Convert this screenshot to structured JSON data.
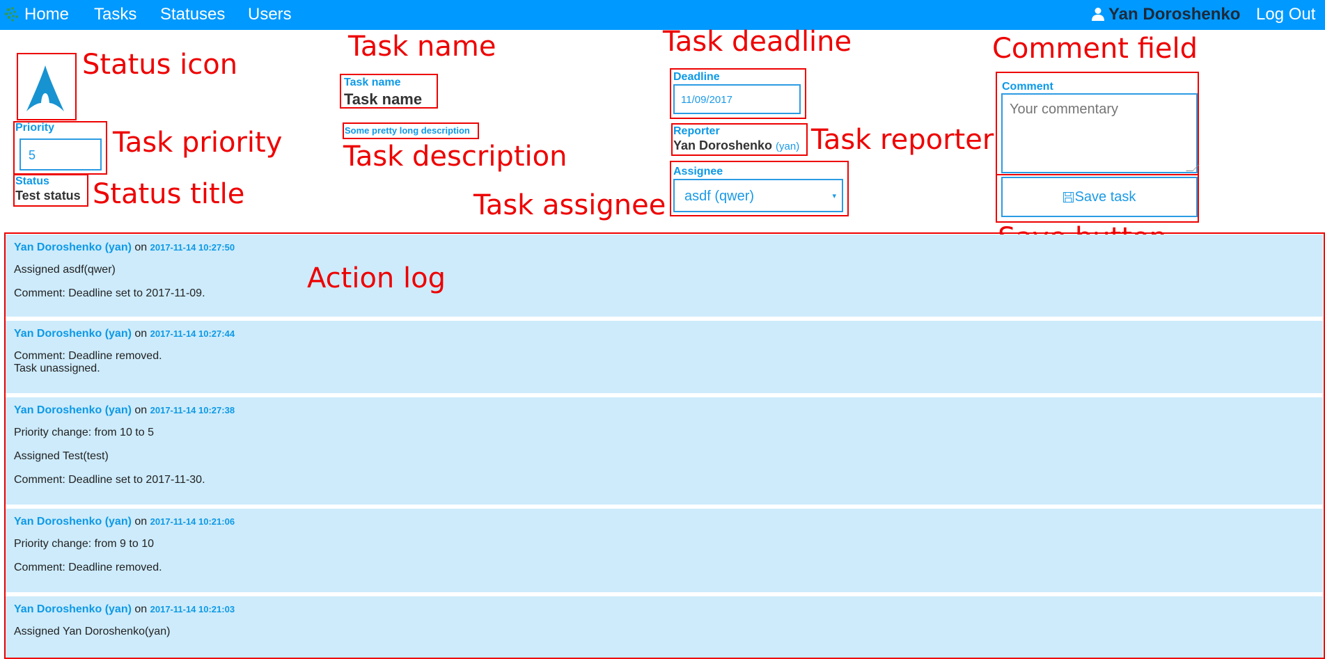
{
  "nav": {
    "links": [
      "Home",
      "Tasks",
      "Statuses",
      "Users"
    ],
    "user": "Yan Doroshenko",
    "logout": "Log Out"
  },
  "task": {
    "priority_label": "Priority",
    "priority_value": "5",
    "status_label": "Status",
    "status_value": "Test status",
    "name_label": "Task name",
    "name_value": "Task name",
    "description": "Some pretty long description",
    "deadline_label": "Deadline",
    "deadline_value": "11/09/2017",
    "reporter_label": "Reporter",
    "reporter_name": "Yan Doroshenko",
    "reporter_login": "(yan)",
    "assignee_label": "Assignee",
    "assignee_value": "asdf (qwer)",
    "comment_label": "Comment",
    "comment_placeholder": "Your commentary",
    "save_label": "Save task"
  },
  "annotations": {
    "status_icon": "Status icon",
    "task_name": "Task name",
    "task_deadline": "Task deadline",
    "comment_field": "Comment field",
    "task_priority": "Task priority",
    "task_description": "Task description",
    "task_reporter": "Task reporter",
    "status_title": "Status title",
    "task_assignee": "Task assignee",
    "save_button": "Save button",
    "action_log": "Action log"
  },
  "log": [
    {
      "author": "Yan Doroshenko (yan)",
      "on": "on",
      "time": "2017-11-14 10:27:50",
      "lines": [
        "Assigned asdf(qwer)",
        "Comment: Deadline set to 2017-11-09."
      ]
    },
    {
      "author": "Yan Doroshenko (yan)",
      "on": "on",
      "time": "2017-11-14 10:27:44",
      "lines": [
        "Comment: Deadline removed.",
        "Task unassigned."
      ]
    },
    {
      "author": "Yan Doroshenko (yan)",
      "on": "on",
      "time": "2017-11-14 10:27:38",
      "lines": [
        "Priority change: from 10 to 5",
        "Assigned Test(test)",
        "Comment: Deadline set to 2017-11-30."
      ]
    },
    {
      "author": "Yan Doroshenko (yan)",
      "on": "on",
      "time": "2017-11-14 10:21:06",
      "lines": [
        "Priority change: from 9 to 10",
        "Comment: Deadline removed."
      ]
    },
    {
      "author": "Yan Doroshenko (yan)",
      "on": "on",
      "time": "2017-11-14 10:21:03",
      "lines": [
        "Assigned Yan Doroshenko(yan)"
      ]
    }
  ],
  "colors": {
    "navbar": "#0099ff",
    "accent": "#0d99e6",
    "annotation": "#ee0000",
    "log_entry_bg": "#cdebfb"
  }
}
